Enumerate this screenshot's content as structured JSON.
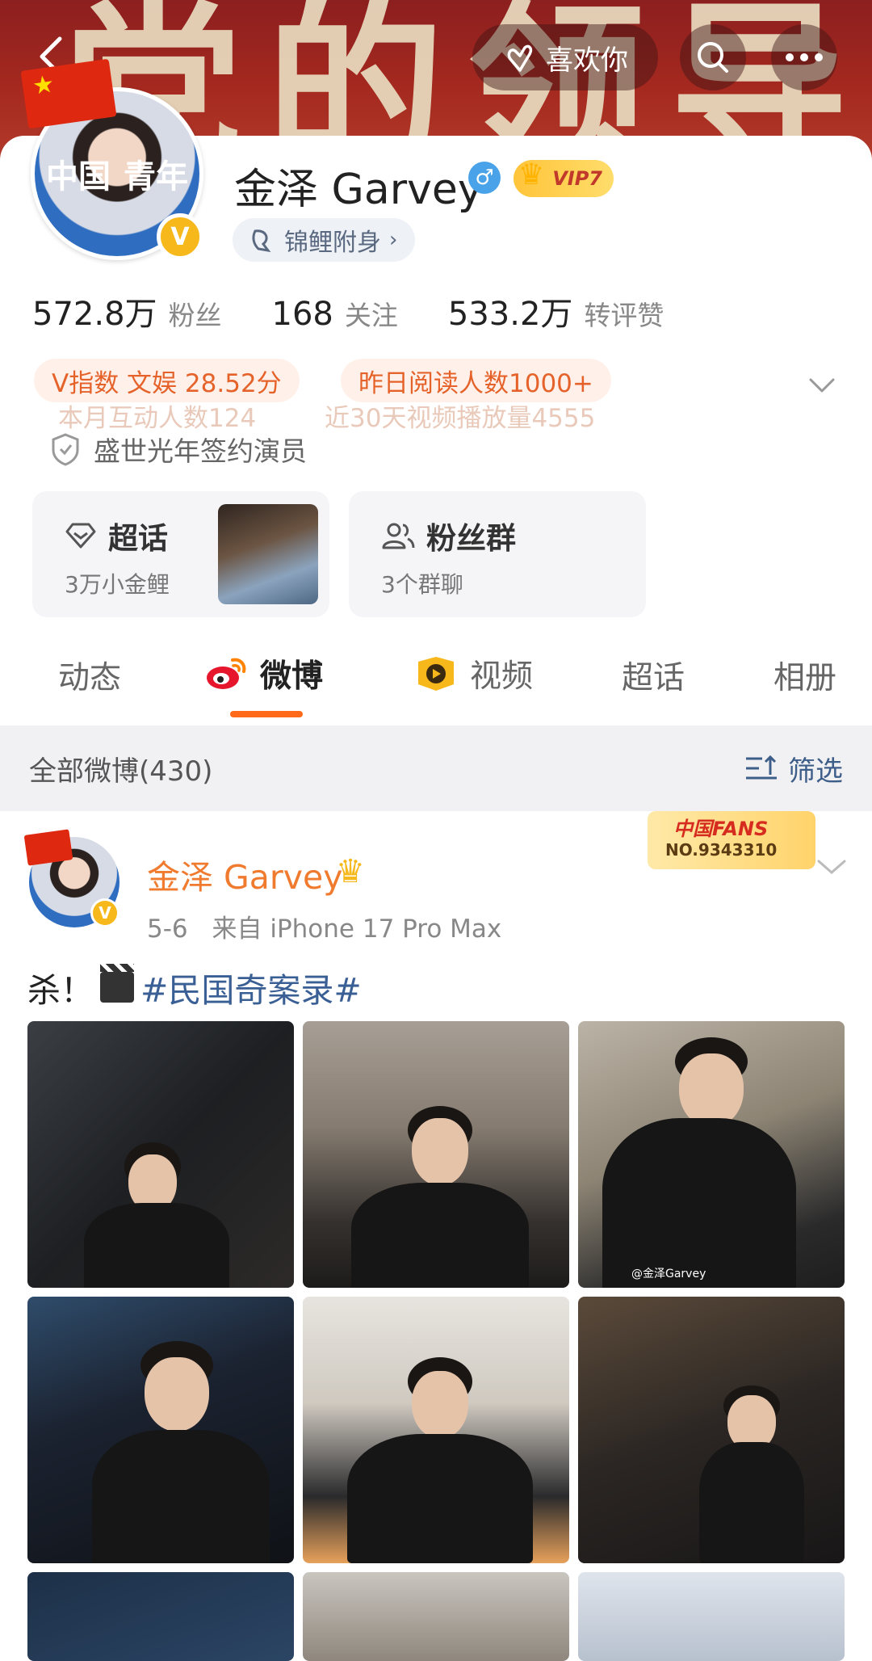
{
  "banner": {
    "deco_text": "党的领导",
    "like_label": "喜欢你"
  },
  "profile": {
    "avatar_left_text": "中国",
    "avatar_right_text": "青年",
    "verified_mark": "V",
    "name": "金泽 Garvey",
    "gender_symbol": "♂",
    "vip_label": "VIP7",
    "koi_label": "锦鲤附身",
    "stats": [
      {
        "value": "572.8万",
        "label": "粉丝"
      },
      {
        "value": "168",
        "label": "关注"
      },
      {
        "value": "533.2万",
        "label": "转评赞"
      }
    ],
    "pills": {
      "v_index": "V指数 文娱 28.52分",
      "yesterday_readers": "昨日阅读人数1000+",
      "monthly_interactions": "本月互动人数124",
      "video_plays": "近30天视频播放量4555"
    },
    "signed_label": "盛世光年签约演员"
  },
  "tiles": {
    "super_topic": {
      "title": "超话",
      "subtitle": "3万小金鲤"
    },
    "fan_group": {
      "title": "粉丝群",
      "subtitle": "3个群聊"
    }
  },
  "tabs": [
    "动态",
    "微博",
    "视频",
    "超话",
    "相册"
  ],
  "active_tab": "微博",
  "filter": {
    "count_label": "全部微博(430)",
    "filter_label": "筛选"
  },
  "post": {
    "author": "金泽 Garvey",
    "date": "5-6",
    "source": "来自 iPhone 17 Pro Max",
    "text_prefix": "杀！",
    "hashtag": "#民国奇案录#",
    "fans_badge_title": "中国FANS",
    "fans_badge_no": "NO.9343310",
    "watermark": "@金泽Garvey"
  },
  "colors": {
    "accent_orange": "#ff6a1a",
    "link_blue": "#3a5f95",
    "banner_red": "#a5291f"
  }
}
